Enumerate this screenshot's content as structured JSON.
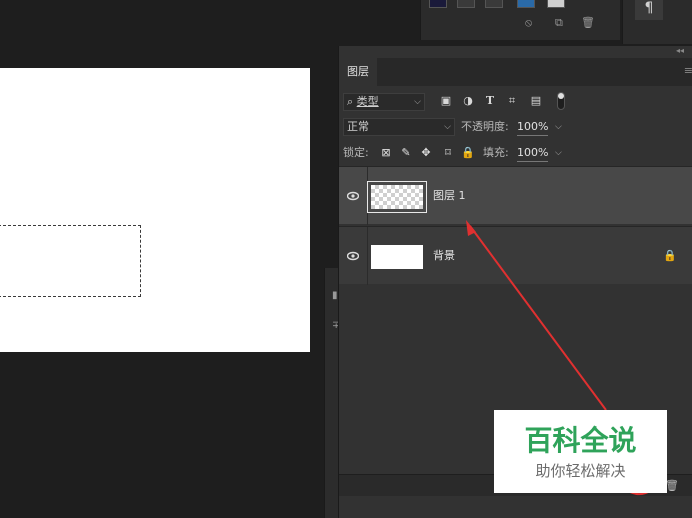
{
  "layers_panel": {
    "tab_label": "图层",
    "filter": {
      "selected": "类型"
    },
    "blend_mode": "正常",
    "opacity_label": "不透明度:",
    "opacity_value": "100%",
    "lock_label": "锁定:",
    "fill_label": "填充:",
    "fill_value": "100%",
    "layers": [
      {
        "name": "图层 1",
        "selected": true,
        "visible": true,
        "thumbnail": "transparent"
      },
      {
        "name": "背景",
        "selected": false,
        "visible": true,
        "thumbnail": "white",
        "locked": true
      }
    ]
  },
  "top_panel": {
    "paragraph_symbol": "¶"
  },
  "icons": [
    "search-icon",
    "image-filter-icon",
    "adjustment-filter-icon",
    "type-filter-icon",
    "shape-filter-icon",
    "smart-object-filter-icon",
    "lock-transparent-icon",
    "lock-brush-icon",
    "lock-move-icon",
    "lock-artboard-icon",
    "lock-all-icon",
    "eye-icon",
    "lock-icon",
    "trash-icon",
    "paragraph-icon"
  ],
  "annotation": {
    "arrow_color": "#e03030"
  },
  "watermark": {
    "title": "百科全说",
    "subtitle": "助你轻松解决",
    "title_color": "#2fa35a"
  }
}
